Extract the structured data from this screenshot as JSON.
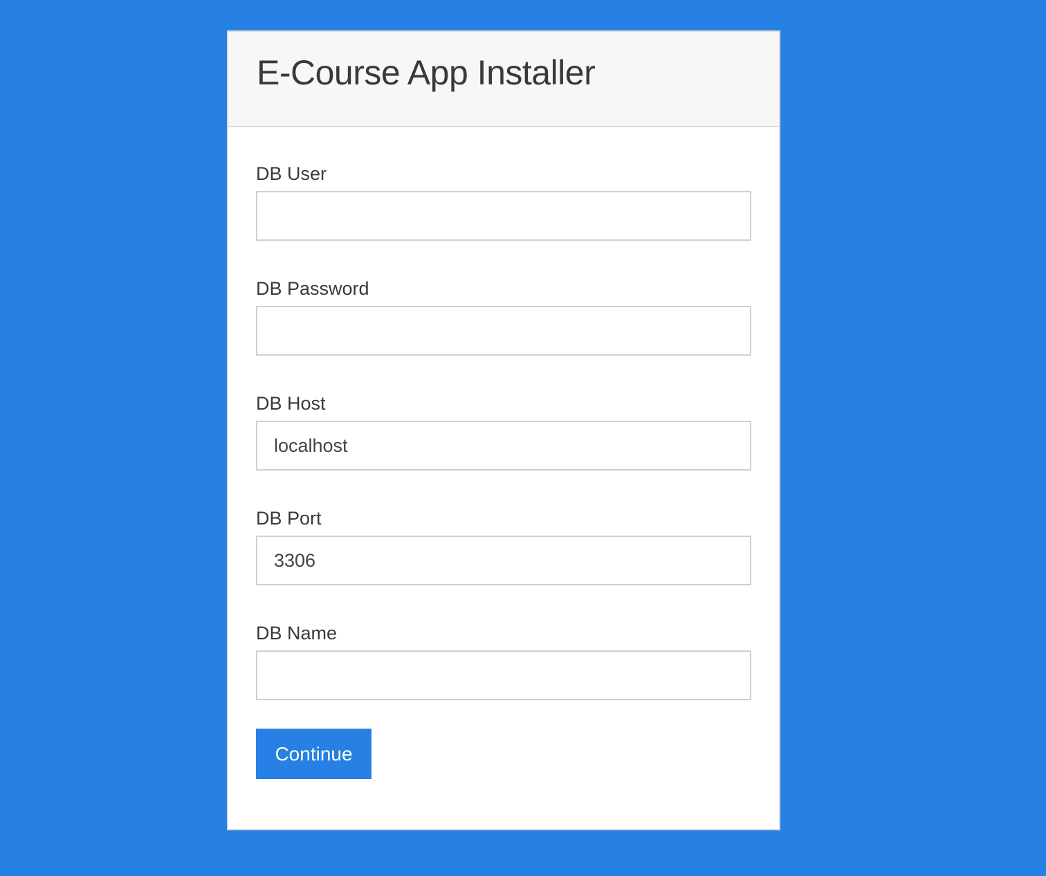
{
  "installer": {
    "title": "E-Course App Installer",
    "fields": [
      {
        "label": "DB User",
        "value": ""
      },
      {
        "label": "DB Password",
        "value": ""
      },
      {
        "label": "DB Host",
        "value": "localhost"
      },
      {
        "label": "DB Port",
        "value": "3306"
      },
      {
        "label": "DB Name",
        "value": ""
      }
    ],
    "continue_label": "Continue"
  },
  "colors": {
    "background": "#2780e3",
    "button": "#2780e3",
    "header_bg": "#f7f7f7"
  }
}
